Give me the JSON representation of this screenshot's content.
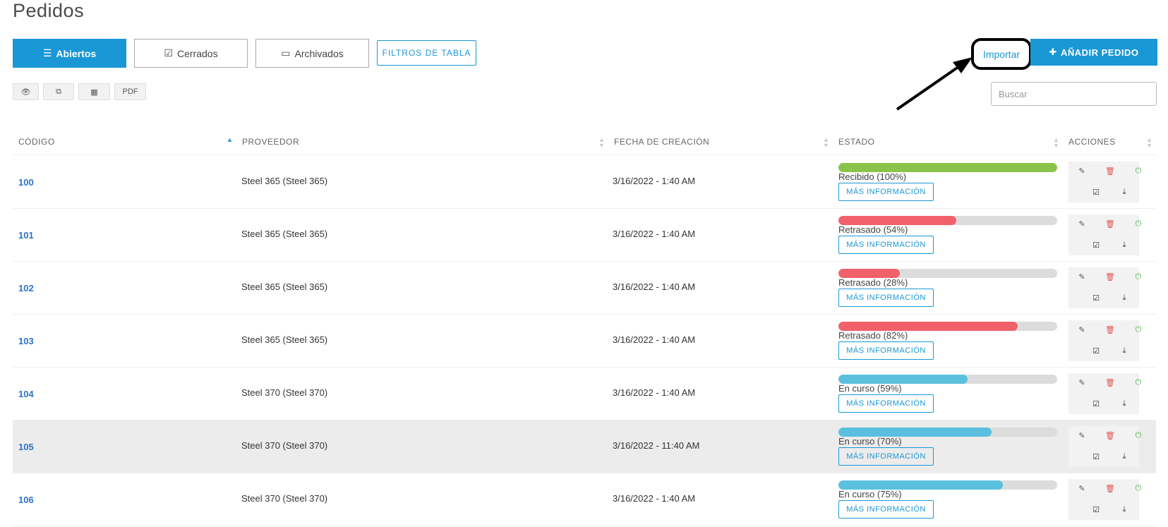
{
  "page_title": "Pedidos",
  "tabs": [
    {
      "label": "Abiertos",
      "icon": "list-icon",
      "active": true
    },
    {
      "label": "Cerrados",
      "icon": "checkbox-icon",
      "active": false
    },
    {
      "label": "Archivados",
      "icon": "inbox-icon",
      "active": false
    }
  ],
  "filters_label": "FILTROS DE TABLA",
  "toolbar": {
    "pdf_label": "PDF"
  },
  "import_label": "Importar",
  "add_label": "AÑADIR PEDIDO",
  "search_placeholder": "Buscar",
  "columns": {
    "codigo": "CÓDIGO",
    "proveedor": "PROVEEDOR",
    "fecha": "FECHA DE CREACIÓN",
    "estado": "ESTADO",
    "acciones": "ACCIONES"
  },
  "more_info_label": "MÁS INFORMACIÓN",
  "colors": {
    "accent": "#1a97d5",
    "received": "#8bc34a",
    "delayed": "#f0616a",
    "in_progress": "#5bc0de"
  },
  "rows": [
    {
      "code": "100",
      "provider": "Steel 365 (Steel 365)",
      "date": "3/16/2022 - 1:40 AM",
      "status": "Recibido (100%)",
      "progress": 100,
      "state": "received"
    },
    {
      "code": "101",
      "provider": "Steel 365 (Steel 365)",
      "date": "3/16/2022 - 1:40 AM",
      "status": "Retrasado (54%)",
      "progress": 54,
      "state": "delayed"
    },
    {
      "code": "102",
      "provider": "Steel 365 (Steel 365)",
      "date": "3/16/2022 - 1:40 AM",
      "status": "Retrasado (28%)",
      "progress": 28,
      "state": "delayed"
    },
    {
      "code": "103",
      "provider": "Steel 365 (Steel 365)",
      "date": "3/16/2022 - 1:40 AM",
      "status": "Retrasado (82%)",
      "progress": 82,
      "state": "delayed"
    },
    {
      "code": "104",
      "provider": "Steel 370 (Steel 370)",
      "date": "3/16/2022 - 1:40 AM",
      "status": "En curso (59%)",
      "progress": 59,
      "state": "in_progress"
    },
    {
      "code": "105",
      "provider": "Steel 370 (Steel 370)",
      "date": "3/16/2022 - 11:40 AM",
      "status": "En curso (70%)",
      "progress": 70,
      "state": "in_progress",
      "highlighted": true
    },
    {
      "code": "106",
      "provider": "Steel 370 (Steel 370)",
      "date": "3/16/2022 - 1:40 AM",
      "status": "En curso (75%)",
      "progress": 75,
      "state": "in_progress"
    }
  ]
}
